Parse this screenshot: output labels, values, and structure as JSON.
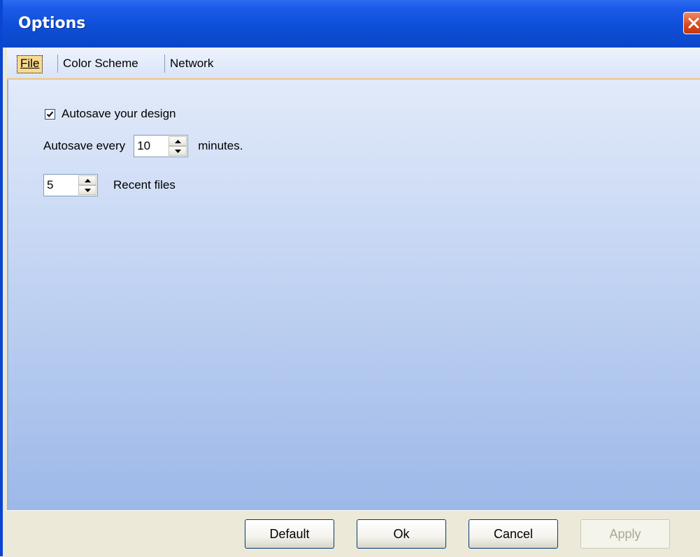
{
  "window": {
    "title": "Options"
  },
  "tabs": [
    {
      "label": "File",
      "active": true
    },
    {
      "label": "Color Scheme",
      "active": false
    },
    {
      "label": "Network",
      "active": false
    }
  ],
  "file_tab": {
    "autosave_checkbox": {
      "label": "Autosave your design",
      "checked": true
    },
    "autosave_interval": {
      "prefix": "Autosave every",
      "value": "10",
      "suffix": "minutes."
    },
    "recent_files": {
      "value": "5",
      "label": "Recent files"
    }
  },
  "buttons": {
    "default_label": "Default",
    "ok_label": "Ok",
    "cancel_label": "Cancel",
    "apply_label": "Apply"
  },
  "colors": {
    "title_bar": "#0e4fd8",
    "close_button": "#d9471b",
    "active_tab": "#f9d98f",
    "panel_top": "#e2eafa",
    "panel_bottom": "#9db8e8",
    "dialog_face": "#ece9d8"
  }
}
